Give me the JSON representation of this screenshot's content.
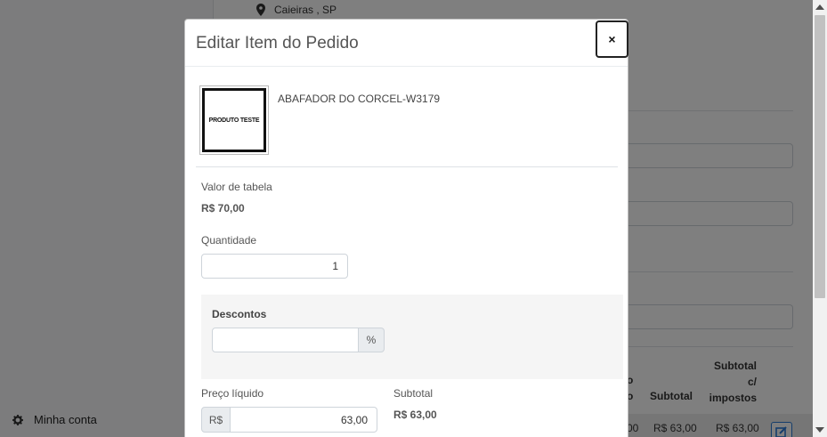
{
  "background": {
    "location": "Caieiras , SP",
    "account_label": "Minha conta",
    "table": {
      "header_cut_1": "o",
      "header_cut_2": "o",
      "header_subtotal": "Subtotal",
      "header_subtotal_impostos": "Subtotal c/ impostos",
      "row_cut": "00",
      "row_subtotal": "R$ 63,00",
      "row_subtotal_impostos": "R$ 63,00"
    }
  },
  "modal": {
    "title": "Editar Item do Pedido",
    "close_label": "×",
    "product": {
      "image_text": "PRODUTO TESTE",
      "name": "ABAFADOR DO CORCEL-W3179"
    },
    "valor_tabela_label": "Valor de tabela",
    "valor_tabela_value": "R$ 70,00",
    "quantidade_label": "Quantidade",
    "quantidade_value": "1",
    "descontos_label": "Descontos",
    "descontos_value": "",
    "descontos_unit": "%",
    "preco_liquido_label": "Preço líquido",
    "preco_currency": "R$",
    "preco_liquido_value": "63,00",
    "subtotal_label": "Subtotal",
    "subtotal_value": "R$ 63,00"
  },
  "colors": {
    "backdrop": "#000000",
    "edit_button": "#2a7bd6"
  }
}
